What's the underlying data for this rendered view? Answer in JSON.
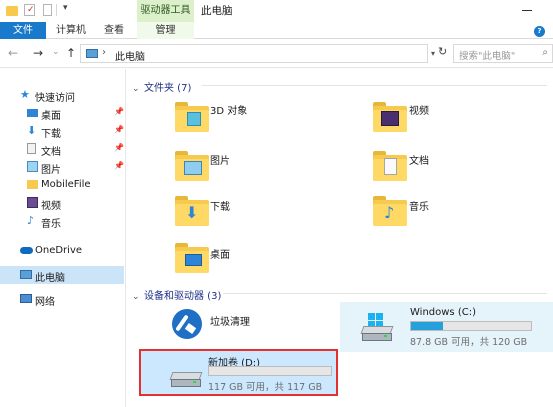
{
  "titlebar": {
    "context_tab": "驱动器工具",
    "window_title": "此电脑",
    "qa_dropdown": "▾"
  },
  "ribbon": {
    "tabs": [
      "文件",
      "计算机",
      "查看",
      "管理"
    ],
    "help": "?"
  },
  "nav": {
    "back": "←",
    "forward": "→",
    "recent": "⌄",
    "up": "↑",
    "breadcrumb_sep": "›",
    "path": "此电脑",
    "search_placeholder": "搜索\"此电脑\""
  },
  "sidebar": {
    "quick_access": "快速访问",
    "items": [
      {
        "label": "桌面",
        "icon": "desktop-icon",
        "pinned": true
      },
      {
        "label": "下载",
        "icon": "download-folder-icon",
        "pinned": true
      },
      {
        "label": "文档",
        "icon": "documents-folder-icon",
        "pinned": true
      },
      {
        "label": "图片",
        "icon": "pictures-folder-icon",
        "pinned": true
      },
      {
        "label": "MobileFile",
        "icon": "folder-icon",
        "pinned": false
      },
      {
        "label": "视频",
        "icon": "videos-folder-icon",
        "pinned": false
      },
      {
        "label": "音乐",
        "icon": "music-folder-icon",
        "pinned": false
      }
    ],
    "onedrive": "OneDrive",
    "this_pc": "此电脑",
    "network": "网络"
  },
  "main": {
    "folders_header": "文件夹 (7)",
    "folders": [
      {
        "label": "3D 对象",
        "icon": "3d-objects-folder-icon"
      },
      {
        "label": "视频",
        "icon": "videos-folder-icon"
      },
      {
        "label": "图片",
        "icon": "pictures-folder-icon"
      },
      {
        "label": "文档",
        "icon": "documents-folder-icon"
      },
      {
        "label": "下载",
        "icon": "download-folder-icon"
      },
      {
        "label": "音乐",
        "icon": "music-folder-icon"
      },
      {
        "label": "桌面",
        "icon": "desktop-folder-icon"
      }
    ],
    "devices_header": "设备和驱动器 (3)",
    "devices": [
      {
        "label": "垃圾清理",
        "icon": "broom-cleanup-icon"
      },
      {
        "label": "Windows (C:)",
        "info": "87.8 GB 可用，共 120 GB",
        "used_fraction": 0.27,
        "icon": "windows-drive-icon"
      },
      {
        "label": "新加卷 (D:)",
        "info": "117 GB 可用，共 117 GB",
        "used_fraction": 0.0,
        "icon": "hard-drive-icon"
      }
    ]
  },
  "colors": {
    "accent": "#1979ca",
    "selection": "#cce8ff",
    "capacity_fill": "#26a0da",
    "highlight_box": "#e53030"
  }
}
